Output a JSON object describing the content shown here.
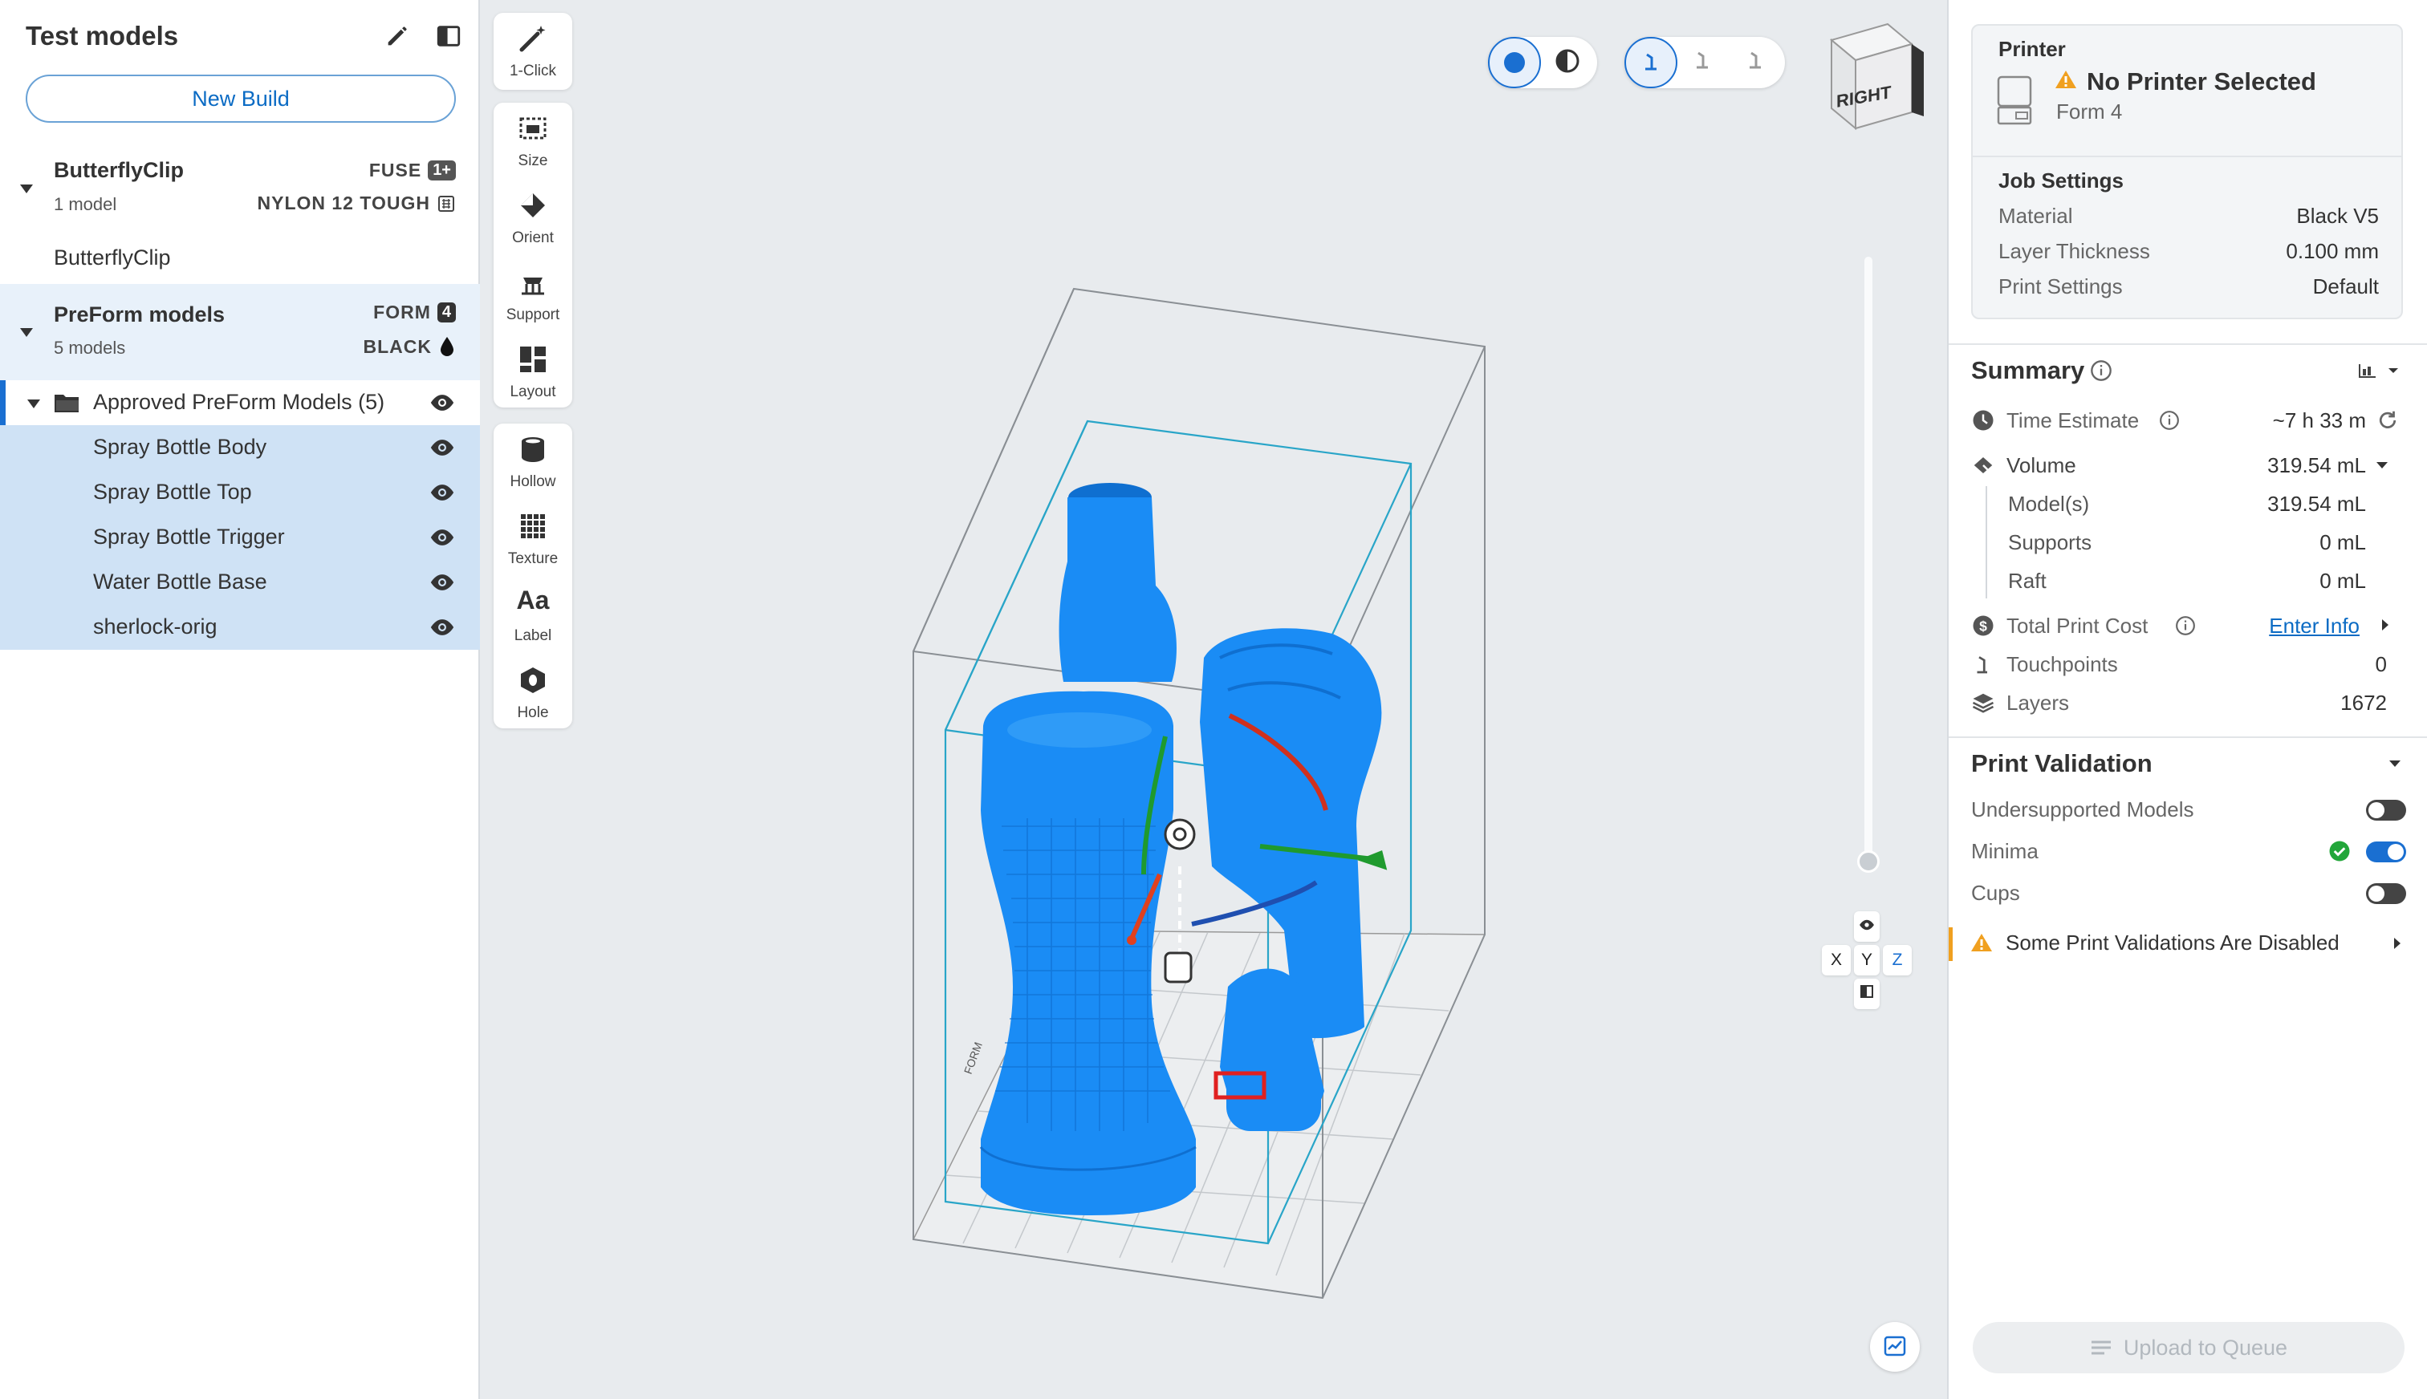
{
  "left_panel": {
    "title": "Test models",
    "new_build_label": "New Build",
    "groups": [
      {
        "name": "ButterflyClip",
        "sub": "1 model",
        "printer": "FUSE",
        "printer_badge": "1+",
        "material": "NYLON 12 TOUGH",
        "models": [
          "ButterflyClip"
        ]
      },
      {
        "name": "PreForm models",
        "sub": "5 models",
        "printer": "FORM",
        "printer_badge": "4",
        "material": "BLACK",
        "folder": "Approved PreForm Models (5)",
        "models": [
          "Spray Bottle Body",
          "Spray Bottle Top",
          "Spray Bottle Trigger",
          "Water Bottle Base",
          "sherlock-orig"
        ]
      }
    ]
  },
  "toolbar": {
    "one_click": "1-Click",
    "size": "Size",
    "orient": "Orient",
    "support": "Support",
    "layout": "Layout",
    "hollow": "Hollow",
    "texture": "Texture",
    "label": "Label",
    "hole": "Hole"
  },
  "viewport": {
    "view_cube_face": "RIGHT",
    "axis_x": "X",
    "axis_y": "Y",
    "axis_z": "Z",
    "build_plate_text": "FORM",
    "model_color": "#1a8cf5",
    "accent_color": "#1a6fd1"
  },
  "right_panel": {
    "printer_heading": "Printer",
    "printer_status": "No Printer Selected",
    "printer_model": "Form 4",
    "job_settings": {
      "heading": "Job Settings",
      "rows": [
        {
          "label": "Material",
          "value": "Black V5"
        },
        {
          "label": "Layer Thickness",
          "value": "0.100 mm"
        },
        {
          "label": "Print Settings",
          "value": "Default"
        }
      ]
    },
    "summary": {
      "heading": "Summary",
      "time_label": "Time Estimate",
      "time_value": "~7 h 33 m",
      "volume_label": "Volume",
      "volume_value": "319.54 mL",
      "models_label": "Model(s)",
      "models_value": "319.54 mL",
      "supports_label": "Supports",
      "supports_value": "0 mL",
      "raft_label": "Raft",
      "raft_value": "0 mL",
      "cost_label": "Total Print Cost",
      "cost_value": "Enter Info",
      "touchpoints_label": "Touchpoints",
      "touchpoints_value": "0",
      "layers_label": "Layers",
      "layers_value": "1672"
    },
    "validation": {
      "heading": "Print Validation",
      "items": [
        {
          "label": "Undersupported Models",
          "on": false
        },
        {
          "label": "Minima",
          "on": true
        },
        {
          "label": "Cups",
          "on": false
        }
      ],
      "warning": "Some Print Validations Are Disabled"
    },
    "upload_label": "Upload to Queue"
  }
}
